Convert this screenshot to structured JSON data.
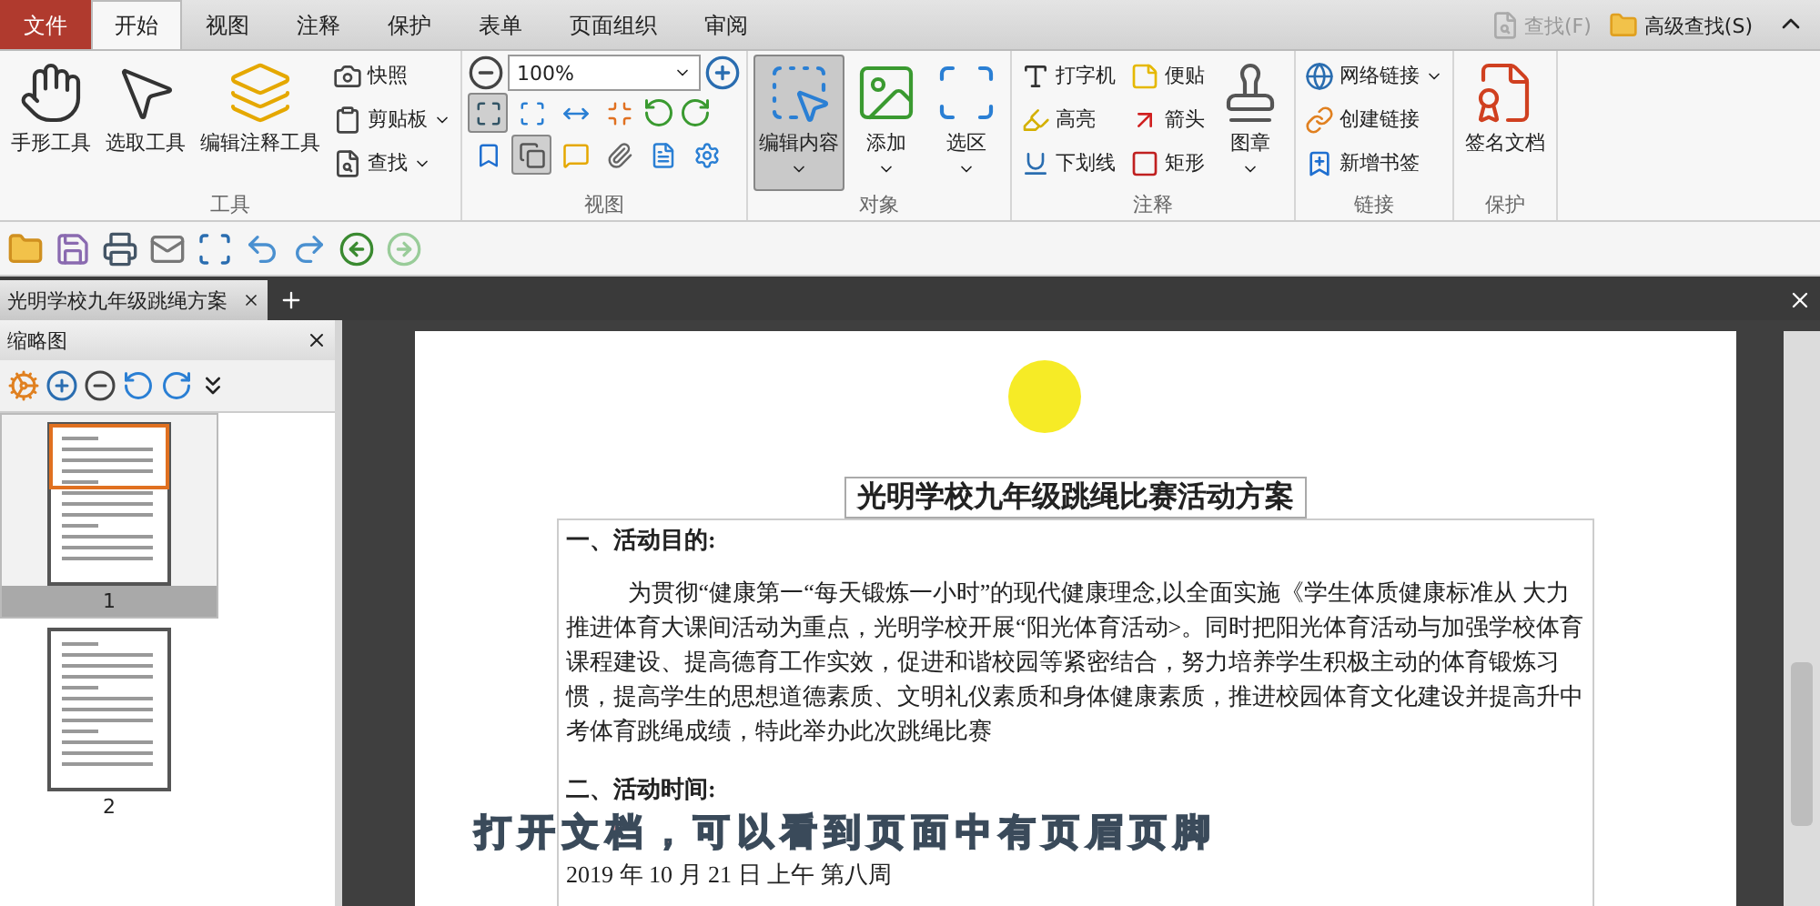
{
  "menu_tabs": [
    {
      "label": "文件",
      "kind": "file",
      "selected": false
    },
    {
      "label": "开始",
      "kind": "tab",
      "selected": true
    },
    {
      "label": "视图",
      "kind": "tab",
      "selected": false
    },
    {
      "label": "注释",
      "kind": "tab",
      "selected": false
    },
    {
      "label": "保护",
      "kind": "tab",
      "selected": false
    },
    {
      "label": "表单",
      "kind": "tab",
      "selected": false
    },
    {
      "label": "页面组织",
      "kind": "tab",
      "selected": false
    },
    {
      "label": "审阅",
      "kind": "tab",
      "selected": false
    }
  ],
  "quick_find": {
    "find": "查找(F)",
    "find_disabled": true,
    "advanced": "高级查找(S)"
  },
  "ribbon": {
    "tools": {
      "label": "工具",
      "large": [
        "手形工具",
        "选取工具",
        "编辑注释工具"
      ],
      "small": [
        "快照",
        "剪贴板",
        "查找"
      ]
    },
    "view": {
      "label": "视图",
      "zoom": "100%",
      "row1": [
        {
          "selected": true
        },
        {
          "selected": false
        },
        {
          "selected": false
        },
        {
          "selected": false
        }
      ],
      "row2": [
        {
          "selected": false
        },
        {
          "selected": true
        },
        {
          "selected": false
        },
        {
          "selected": false
        },
        {
          "selected": false
        },
        {
          "selected": false
        }
      ]
    },
    "objects": {
      "label": "对象",
      "buttons": [
        {
          "label": "编辑内容",
          "selected": true
        },
        {
          "label": "添加",
          "selected": false
        },
        {
          "label": "选区",
          "selected": false
        }
      ]
    },
    "comments": {
      "label": "注释",
      "tools": [
        "打字机",
        "便贴",
        "高亮",
        "箭头",
        "下划线",
        "矩形"
      ],
      "stamp": "图章"
    },
    "links": {
      "label": "链接",
      "items": [
        "网络链接",
        "创建链接",
        "新增书签"
      ]
    },
    "protect": {
      "label": "保护",
      "sign": "签名文档"
    }
  },
  "doc_tab": {
    "title": "光明学校九年级跳绳方案"
  },
  "thumbnails": {
    "title": "缩略图",
    "pages": [
      {
        "label": "1",
        "selected": true
      },
      {
        "label": "2",
        "selected": false
      }
    ]
  },
  "document": {
    "title": "光明学校九年级跳绳比赛活动方案",
    "sections": [
      {
        "heading": "一、活动目的:",
        "paragraph": "为贯彻“健康第一“每天锻炼一小时”的现代健康理念,以全面实施《学生体质健康标准从 大力推进体育大课间活动为重点，光明学校开展“阳光体育活动>。同时把阳光体育活动与加强学校体育课程建设、提高德育工作实效，促进和谐校园等紧密结合，努力培养学生积极主动的体育锻炼习惯，提高学生的思想道德素质、文明礼仪素质和身体健康素质，推进校园体育文化建设并提高升中考体育跳绳成绩，特此举办此次跳绳比赛",
        "indent": true
      },
      {
        "heading": "二、活动时间:",
        "paragraph": "2019 年 10 月 21 日 上午 第八周",
        "indent": false
      }
    ]
  },
  "caption": "打开文档，可以看到页面中有页眉页脚"
}
